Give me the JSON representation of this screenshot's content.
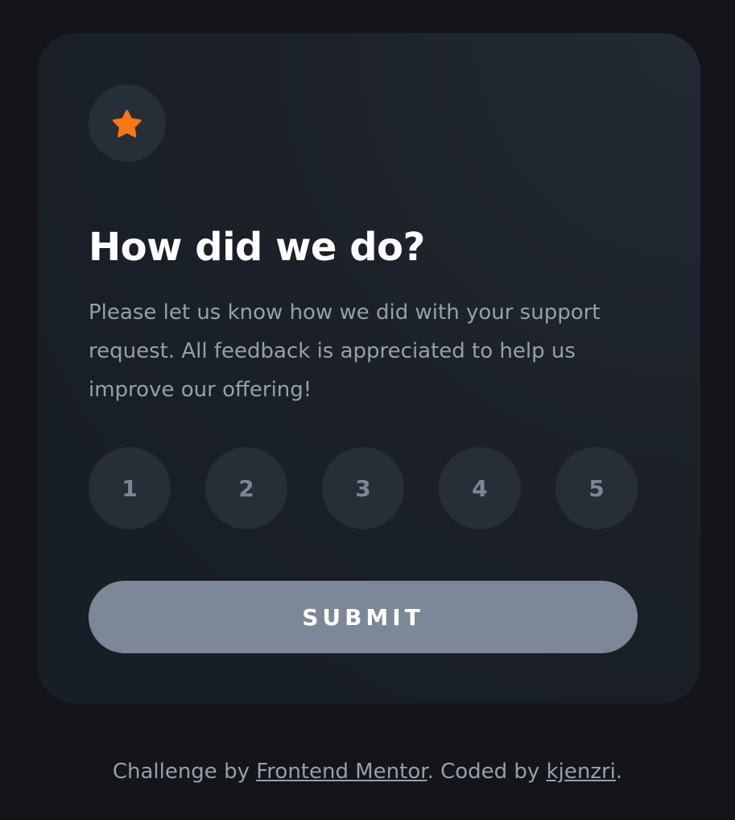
{
  "card": {
    "icon": "star-icon",
    "title": "How did we do?",
    "description": "Please let us know how we did with your support request. All feedback is appreciated to help us improve our offering!",
    "ratings": [
      "1",
      "2",
      "3",
      "4",
      "5"
    ],
    "submit_label": "SUBMIT"
  },
  "footer": {
    "prefix": "Challenge by ",
    "challenge_link": "Frontend Mentor",
    "middle": ". Coded by ",
    "author_link": "kjenzri",
    "suffix": "."
  },
  "colors": {
    "background": "#131518",
    "card": "#1f252d",
    "accent": "#fc7614",
    "button": "#7c8798",
    "rating_bg": "#262e38"
  }
}
